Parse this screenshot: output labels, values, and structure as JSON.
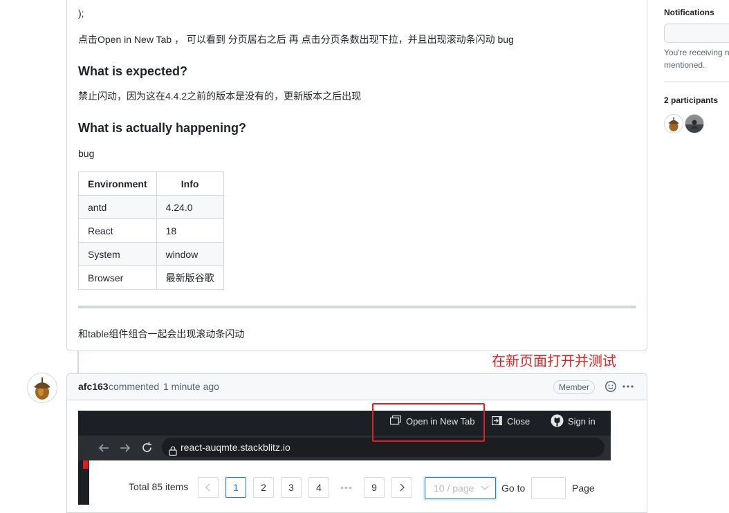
{
  "issue": {
    "code_tail_1": ")",
    "code_tail_2": ");",
    "repro_text": "点击Open in New Tab ，  可以看到 分页居右之后 再 点击分页条数出现下拉，并且出现滚动条闪动 bug",
    "expected_heading": "What is expected?",
    "expected_text": "禁止闪动，因为这在4.4.2之前的版本是没有的，更新版本之后出现",
    "actual_heading": "What is actually happening?",
    "actual_text": "bug",
    "env_table": {
      "headers": [
        "Environment",
        "Info"
      ],
      "rows": [
        [
          "antd",
          "4.24.0"
        ],
        [
          "React",
          "18"
        ],
        [
          "System",
          "window"
        ],
        [
          "Browser",
          "最新版谷歌"
        ]
      ]
    },
    "footer_text": "和table组件组合一起会出现滚动条闪动"
  },
  "annotation": {
    "text": "在新页面打开并测试",
    "color": "#e02020"
  },
  "comment": {
    "author": "afc163",
    "action": "commented",
    "time": "1 minute ago",
    "badge": "Member",
    "screenshot": {
      "open_new_tab": "Open in New Tab",
      "close": "Close",
      "sign_in": "Sign in",
      "url": "react-auqmte.stackblitz.io",
      "total": "Total 85 items",
      "pages": [
        "1",
        "2",
        "3",
        "4",
        "•••",
        "9"
      ],
      "active_page": "1",
      "page_size": "10 / page",
      "goto_label": "Go to",
      "page_label": "Page"
    }
  },
  "sidebar": {
    "notifications_label": "Notifications",
    "notifications_text_1": "You're receiving n",
    "notifications_text_2": "mentioned.",
    "participants_label": "2 participants"
  },
  "colors": {
    "border": "#d0d7de",
    "accent": "#1677ff",
    "dark_toolbar": "#1c1f23"
  }
}
